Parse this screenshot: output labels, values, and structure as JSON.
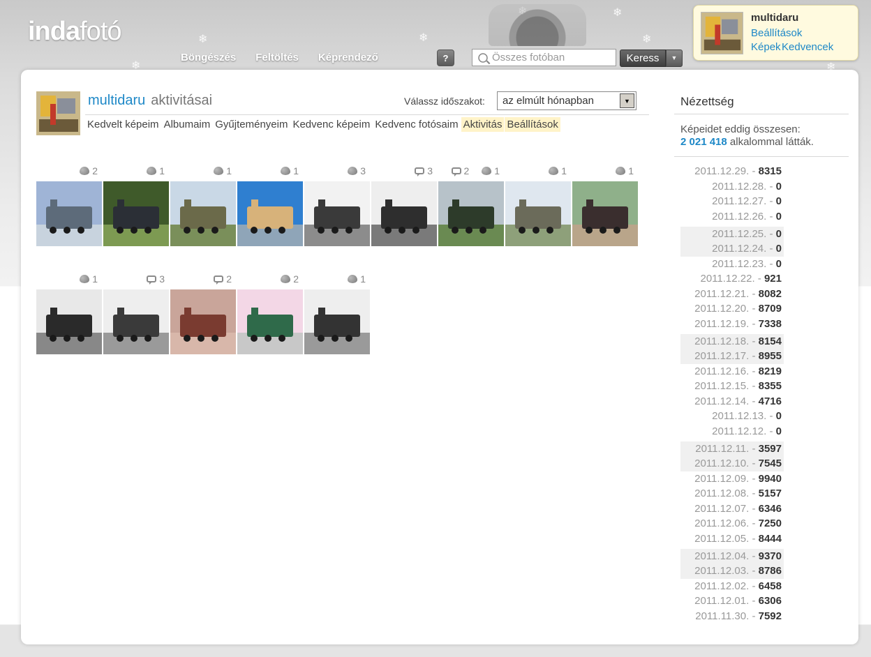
{
  "header": {
    "logo_bold": "inda",
    "logo_light": "fotó",
    "nav": [
      "Böngészés",
      "Feltöltés",
      "Képrendező"
    ],
    "help_label": "?",
    "search_placeholder": "Összes fotóban",
    "search_button": "Keress"
  },
  "userbox": {
    "username": "multidaru",
    "links": [
      "Beállítások",
      "Képek",
      "Kedvencek"
    ]
  },
  "page": {
    "username": "multidaru",
    "title_suffix": "aktivitásai",
    "period_label": "Válassz időszakot:",
    "period_selected": "az elmúlt hónapban",
    "subnav": [
      {
        "label": "Kedvelt képeim",
        "active": false
      },
      {
        "label": "Albumaim",
        "active": false
      },
      {
        "label": "Gyűjteményeim",
        "active": false
      },
      {
        "label": "Kedvenc képeim",
        "active": false
      },
      {
        "label": "Kedvenc fotósaim",
        "active": false
      },
      {
        "label": "Aktivitás",
        "active": true
      },
      {
        "label": "Beállítások",
        "active": true
      }
    ]
  },
  "photos": [
    {
      "comments": null,
      "likes": "2",
      "colors": [
        "#9fb4d6",
        "#5d6b7a",
        "#c8d3de"
      ]
    },
    {
      "comments": null,
      "likes": "1",
      "colors": [
        "#3f5a2a",
        "#2b2f36",
        "#7d9a52"
      ]
    },
    {
      "comments": null,
      "likes": "1",
      "colors": [
        "#c9d8e6",
        "#6b6a4a",
        "#7a8f5a"
      ]
    },
    {
      "comments": null,
      "likes": "1",
      "colors": [
        "#2f7fd0",
        "#d7b27a",
        "#8fa5b8"
      ]
    },
    {
      "comments": null,
      "likes": "3",
      "colors": [
        "#f2f2f2",
        "#3a3a3a",
        "#8c8c8c"
      ]
    },
    {
      "comments": "3",
      "likes": null,
      "colors": [
        "#eeeeee",
        "#2e2e2e",
        "#7a7a7a"
      ]
    },
    {
      "comments": "2",
      "likes": "1",
      "colors": [
        "#b7c2c9",
        "#2d3b2a",
        "#6a8a52"
      ]
    },
    {
      "comments": null,
      "likes": "1",
      "colors": [
        "#dfe7ef",
        "#6b6b5a",
        "#8ea07a"
      ]
    },
    {
      "comments": null,
      "likes": "1",
      "colors": [
        "#8fb08a",
        "#3a2e2e",
        "#b9a58a"
      ]
    },
    {
      "comments": null,
      "likes": "1",
      "colors": [
        "#e8e8e8",
        "#2a2a2a",
        "#888888"
      ]
    },
    {
      "comments": "3",
      "likes": null,
      "colors": [
        "#eeeeee",
        "#3a3a3a",
        "#9a9a9a"
      ]
    },
    {
      "comments": "2",
      "likes": null,
      "colors": [
        "#c9a59a",
        "#7a3b30",
        "#d8b7aa"
      ]
    },
    {
      "comments": null,
      "likes": "2",
      "colors": [
        "#f3d7e6",
        "#2f6a4a",
        "#c8c8c8"
      ]
    },
    {
      "comments": null,
      "likes": "1",
      "colors": [
        "#eeeeee",
        "#333333",
        "#9a9a9a"
      ]
    }
  ],
  "views": {
    "title": "Nézettség",
    "summary_prefix": "Képeidet eddig összesen:",
    "total": "2 021 418",
    "summary_suffix": "alkalommal látták.",
    "days": [
      {
        "date": "2011.12.29.",
        "count": "8315",
        "shade": false
      },
      {
        "date": "2011.12.28.",
        "count": "0",
        "shade": false
      },
      {
        "date": "2011.12.27.",
        "count": "0",
        "shade": false
      },
      {
        "date": "2011.12.26.",
        "count": "0",
        "shade": false
      },
      {
        "date": "2011.12.25.",
        "count": "0",
        "shade": true
      },
      {
        "date": "2011.12.24.",
        "count": "0",
        "shade": true
      },
      {
        "date": "2011.12.23.",
        "count": "0",
        "shade": false
      },
      {
        "date": "2011.12.22.",
        "count": "921",
        "shade": false
      },
      {
        "date": "2011.12.21.",
        "count": "8082",
        "shade": false
      },
      {
        "date": "2011.12.20.",
        "count": "8709",
        "shade": false
      },
      {
        "date": "2011.12.19.",
        "count": "7338",
        "shade": false
      },
      {
        "date": "2011.12.18.",
        "count": "8154",
        "shade": true
      },
      {
        "date": "2011.12.17.",
        "count": "8955",
        "shade": true
      },
      {
        "date": "2011.12.16.",
        "count": "8219",
        "shade": false
      },
      {
        "date": "2011.12.15.",
        "count": "8355",
        "shade": false
      },
      {
        "date": "2011.12.14.",
        "count": "4716",
        "shade": false
      },
      {
        "date": "2011.12.13.",
        "count": "0",
        "shade": false
      },
      {
        "date": "2011.12.12.",
        "count": "0",
        "shade": false
      },
      {
        "date": "2011.12.11.",
        "count": "3597",
        "shade": true
      },
      {
        "date": "2011.12.10.",
        "count": "7545",
        "shade": true
      },
      {
        "date": "2011.12.09.",
        "count": "9940",
        "shade": false
      },
      {
        "date": "2011.12.08.",
        "count": "5157",
        "shade": false
      },
      {
        "date": "2011.12.07.",
        "count": "6346",
        "shade": false
      },
      {
        "date": "2011.12.06.",
        "count": "7250",
        "shade": false
      },
      {
        "date": "2011.12.05.",
        "count": "8444",
        "shade": false
      },
      {
        "date": "2011.12.04.",
        "count": "9370",
        "shade": true
      },
      {
        "date": "2011.12.03.",
        "count": "8786",
        "shade": true
      },
      {
        "date": "2011.12.02.",
        "count": "6458",
        "shade": false
      },
      {
        "date": "2011.12.01.",
        "count": "6306",
        "shade": false
      },
      {
        "date": "2011.11.30.",
        "count": "7592",
        "shade": false
      }
    ]
  }
}
